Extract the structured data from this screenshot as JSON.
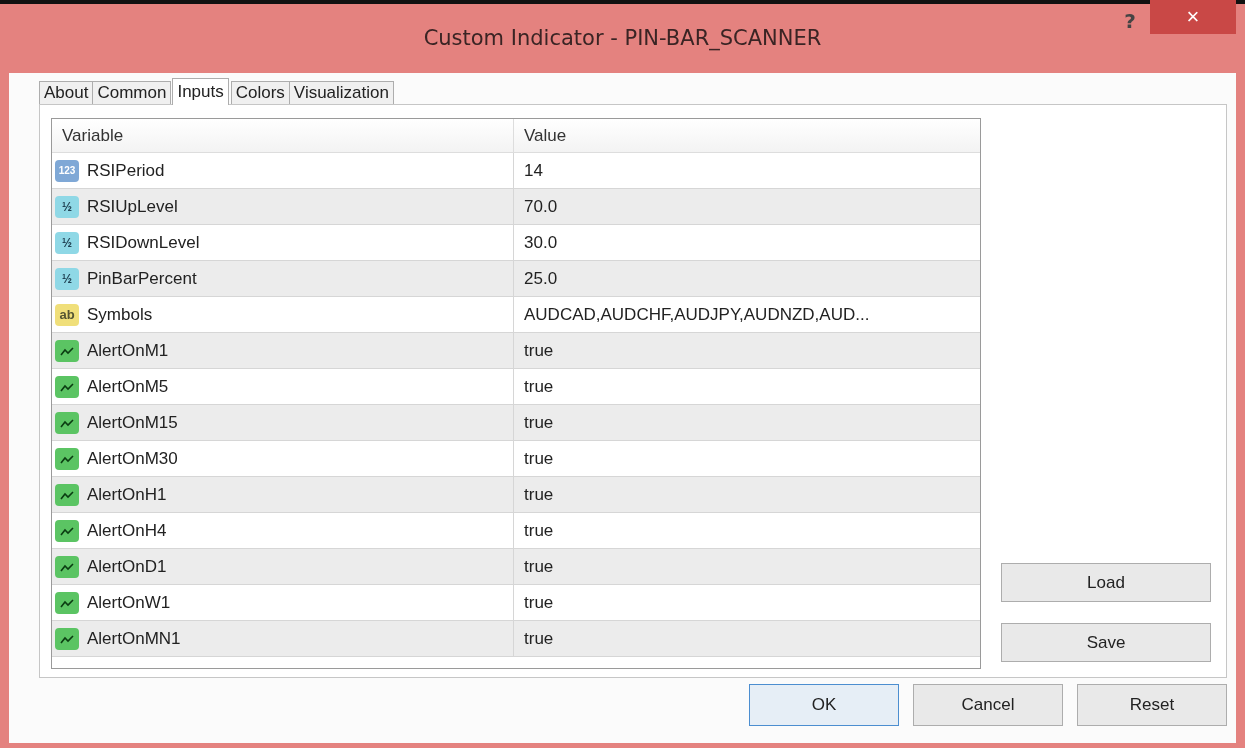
{
  "window": {
    "title": "Custom Indicator - PIN-BAR_SCANNER",
    "help": "?",
    "close": "×"
  },
  "tabs": [
    {
      "label": "About",
      "selected": false
    },
    {
      "label": "Common",
      "selected": false
    },
    {
      "label": "Inputs",
      "selected": true
    },
    {
      "label": "Colors",
      "selected": false
    },
    {
      "label": "Visualization",
      "selected": false
    }
  ],
  "table": {
    "columns": [
      "Variable",
      "Value"
    ],
    "rows": [
      {
        "kind": "int",
        "icon_text": "123",
        "variable": "RSIPeriod",
        "value": "14"
      },
      {
        "kind": "double",
        "icon_text": "½",
        "variable": "RSIUpLevel",
        "value": "70.0"
      },
      {
        "kind": "double",
        "icon_text": "½",
        "variable": "RSIDownLevel",
        "value": "30.0"
      },
      {
        "kind": "double",
        "icon_text": "½",
        "variable": "PinBarPercent",
        "value": "25.0"
      },
      {
        "kind": "string",
        "icon_text": "ab",
        "variable": "Symbols",
        "value": "AUDCAD,AUDCHF,AUDJPY,AUDNZD,AUD..."
      },
      {
        "kind": "bool",
        "variable": "AlertOnM1",
        "value": "true"
      },
      {
        "kind": "bool",
        "variable": "AlertOnM5",
        "value": "true"
      },
      {
        "kind": "bool",
        "variable": "AlertOnM15",
        "value": "true"
      },
      {
        "kind": "bool",
        "variable": "AlertOnM30",
        "value": "true"
      },
      {
        "kind": "bool",
        "variable": "AlertOnH1",
        "value": "true"
      },
      {
        "kind": "bool",
        "variable": "AlertOnH4",
        "value": "true"
      },
      {
        "kind": "bool",
        "variable": "AlertOnD1",
        "value": "true"
      },
      {
        "kind": "bool",
        "variable": "AlertOnW1",
        "value": "true"
      },
      {
        "kind": "bool",
        "variable": "AlertOnMN1",
        "value": "true"
      }
    ]
  },
  "side_buttons": [
    "Load",
    "Save"
  ],
  "buttons": [
    {
      "label": "OK",
      "default": true
    },
    {
      "label": "Cancel",
      "default": false
    },
    {
      "label": "Reset",
      "default": false
    }
  ]
}
